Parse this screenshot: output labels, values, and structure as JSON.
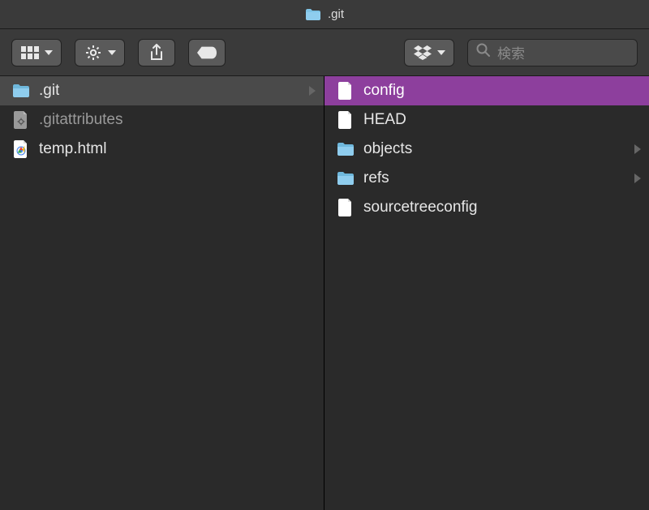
{
  "window": {
    "title": ".git"
  },
  "search": {
    "placeholder": "検索"
  },
  "columns": [
    {
      "items": [
        {
          "name": ".git",
          "icon": "folder",
          "selected": "grey",
          "hasChildren": true
        },
        {
          "name": ".gitattributes",
          "icon": "gear-doc",
          "selected": null,
          "hasChildren": false
        },
        {
          "name": "temp.html",
          "icon": "html-doc",
          "selected": null,
          "hasChildren": false
        }
      ]
    },
    {
      "items": [
        {
          "name": "config",
          "icon": "file",
          "selected": "purple",
          "hasChildren": false
        },
        {
          "name": "HEAD",
          "icon": "file",
          "selected": null,
          "hasChildren": false
        },
        {
          "name": "objects",
          "icon": "folder",
          "selected": null,
          "hasChildren": true
        },
        {
          "name": "refs",
          "icon": "folder",
          "selected": null,
          "hasChildren": true
        },
        {
          "name": "sourcetreeconfig",
          "icon": "file",
          "selected": null,
          "hasChildren": false
        }
      ]
    }
  ]
}
